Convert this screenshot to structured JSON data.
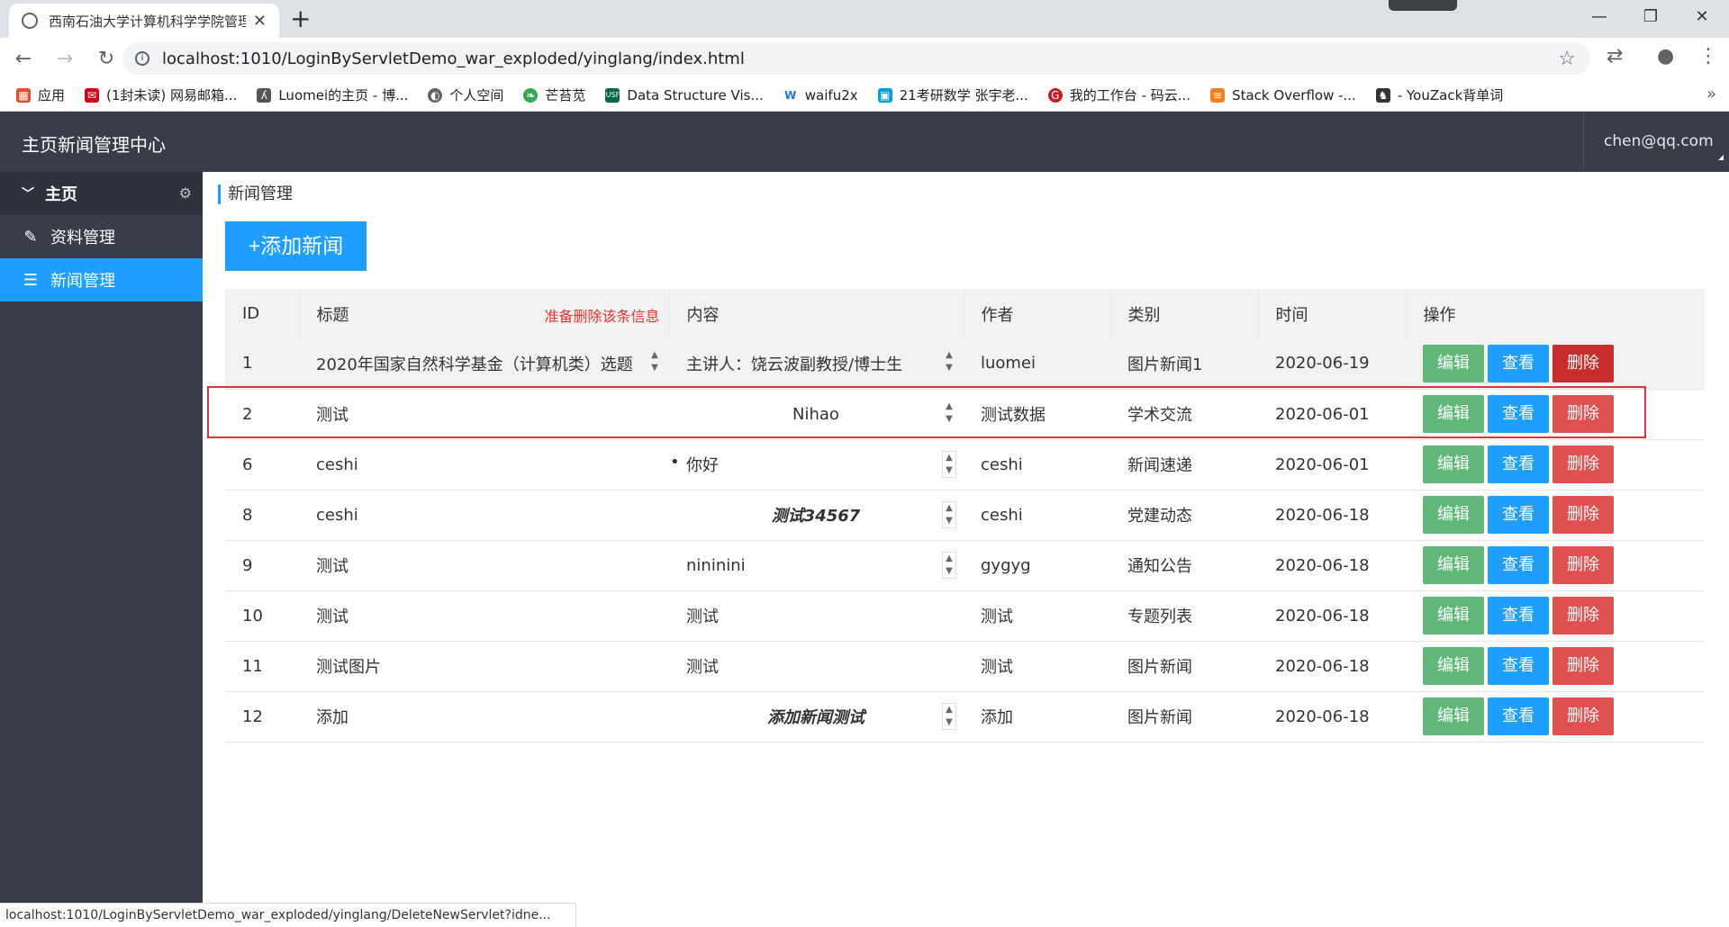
{
  "browser": {
    "tab_title": "西南石油大学计算机科学学院管理",
    "tab_close": "✕",
    "new_tab": "+",
    "url": "localhost:1010/LoginByServletDemo_war_exploded/yinglang/index.html",
    "window_min": "—",
    "window_max": "❐",
    "window_close": "✕",
    "bookmarks": [
      {
        "label": "应用",
        "icon": "apps-grid-icon",
        "color": "#e44d26"
      },
      {
        "label": "(1封未读) 网易邮箱...",
        "icon": "netease-mail-icon",
        "color": "#d0021b"
      },
      {
        "label": "Luomei的主页 - 博...",
        "icon": "blog-icon",
        "color": "#555555"
      },
      {
        "label": "个人空间",
        "icon": "globe-icon",
        "color": "#5f6368"
      },
      {
        "label": "芒苔苋",
        "icon": "leaf-icon",
        "color": "#34a853"
      },
      {
        "label": "Data Structure Vis...",
        "icon": "usf-icon",
        "color": "#006747"
      },
      {
        "label": "waifu2x",
        "icon": "waifu-icon",
        "color": "#1a73e8"
      },
      {
        "label": "21考研数学 张宇老...",
        "icon": "bilibili-icon",
        "color": "#00a1d6"
      },
      {
        "label": "我的工作台 - 码云...",
        "icon": "gitee-icon",
        "color": "#c71d23"
      },
      {
        "label": "Stack Overflow -...",
        "icon": "stackoverflow-icon",
        "color": "#f48024"
      },
      {
        "label": "- YouZack背单词",
        "icon": "youzack-icon",
        "color": "#333333"
      }
    ],
    "status_url": "localhost:1010/LoginByServletDemo_war_exploded/yinglang/DeleteNewServlet?idne..."
  },
  "header": {
    "title": "主页新闻管理中心",
    "user": "chen@qq.com"
  },
  "sidebar": {
    "section": "主页",
    "items": [
      {
        "label": "资料管理",
        "active": false
      },
      {
        "label": "新闻管理",
        "active": true
      }
    ]
  },
  "main": {
    "breadcrumb": "新闻管理",
    "add_button": "+添加新闻",
    "delete_hint": "准备删除该条信息",
    "columns": [
      "ID",
      "标题",
      "内容",
      "作者",
      "类别",
      "时间",
      "操作"
    ],
    "ops": {
      "edit": "编辑",
      "view": "查看",
      "delete": "删除"
    },
    "rows": [
      {
        "id": "1",
        "title": "2020年国家自然科学基金（计算机类）选题",
        "content": "主讲人：饶云波副教授/博士生",
        "author": "luomei",
        "category": "图片新闻1",
        "time": "2020-06-19"
      },
      {
        "id": "2",
        "title": "测试",
        "content": "Nihao",
        "author": "测试数据",
        "category": "学术交流",
        "time": "2020-06-01"
      },
      {
        "id": "6",
        "title": "ceshi",
        "content": "你好",
        "author": "ceshi",
        "category": "新闻速递",
        "time": "2020-06-01"
      },
      {
        "id": "8",
        "title": "ceshi",
        "content": "测试34567",
        "author": "ceshi",
        "category": "党建动态",
        "time": "2020-06-18"
      },
      {
        "id": "9",
        "title": "测试",
        "content": "nininini",
        "author": "gygyg",
        "category": "通知公告",
        "time": "2020-06-18"
      },
      {
        "id": "10",
        "title": "测试",
        "content": "测试",
        "author": "测试",
        "category": "专题列表",
        "time": "2020-06-18"
      },
      {
        "id": "11",
        "title": "测试图片",
        "content": "测试",
        "author": "测试",
        "category": "图片新闻",
        "time": "2020-06-18"
      },
      {
        "id": "12",
        "title": "添加",
        "content": "添加新闻测试",
        "author": "添加",
        "category": "图片新闻",
        "time": "2020-06-18"
      }
    ]
  }
}
